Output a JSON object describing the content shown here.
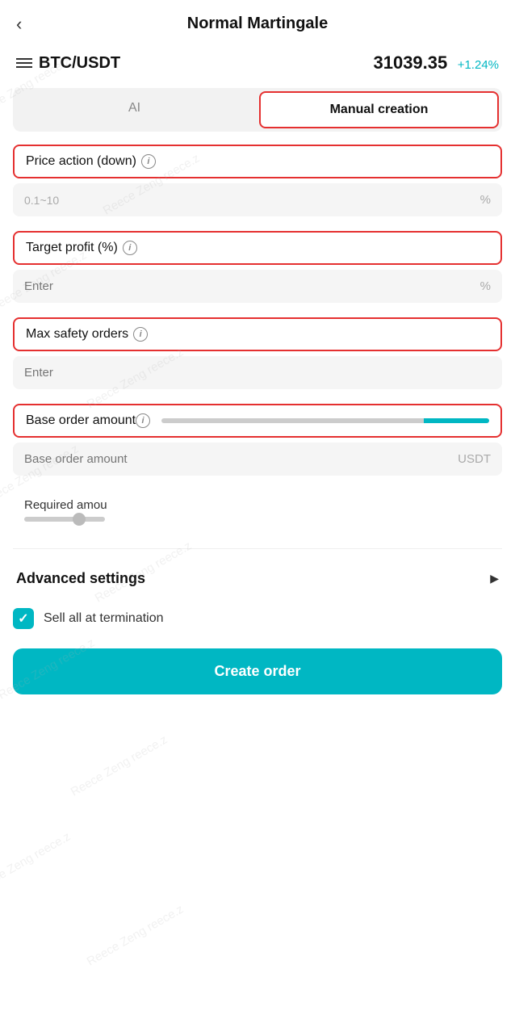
{
  "header": {
    "back_label": "‹",
    "title": "Normal Martingale"
  },
  "symbol_bar": {
    "symbol": "BTC/USDT",
    "price": "31039.35",
    "change": "+1.24%"
  },
  "tabs": [
    {
      "id": "ai",
      "label": "AI",
      "active": false
    },
    {
      "id": "manual",
      "label": "Manual creation",
      "active": true
    }
  ],
  "fields": {
    "price_action": {
      "label": "Price action (down)",
      "info": "i",
      "range_hint": "0.1~10",
      "suffix": "%"
    },
    "target_profit": {
      "label": "Target profit (%)",
      "info": "i",
      "placeholder": "Enter",
      "suffix": "%"
    },
    "max_safety_orders": {
      "label": "Max safety orders",
      "info": "i",
      "placeholder": "Enter"
    },
    "base_order_amount": {
      "label": "Base order amount",
      "info": "i",
      "placeholder": "Base order amount",
      "suffix": "USDT"
    }
  },
  "required_amount": {
    "label": "Required amou"
  },
  "advanced_settings": {
    "label": "Advanced settings",
    "chevron": "▶"
  },
  "sell_termination": {
    "label": "Sell all at termination",
    "checked": true
  },
  "create_button": {
    "label": "Create order"
  },
  "watermark_text": "Reece Zeng reece.z"
}
